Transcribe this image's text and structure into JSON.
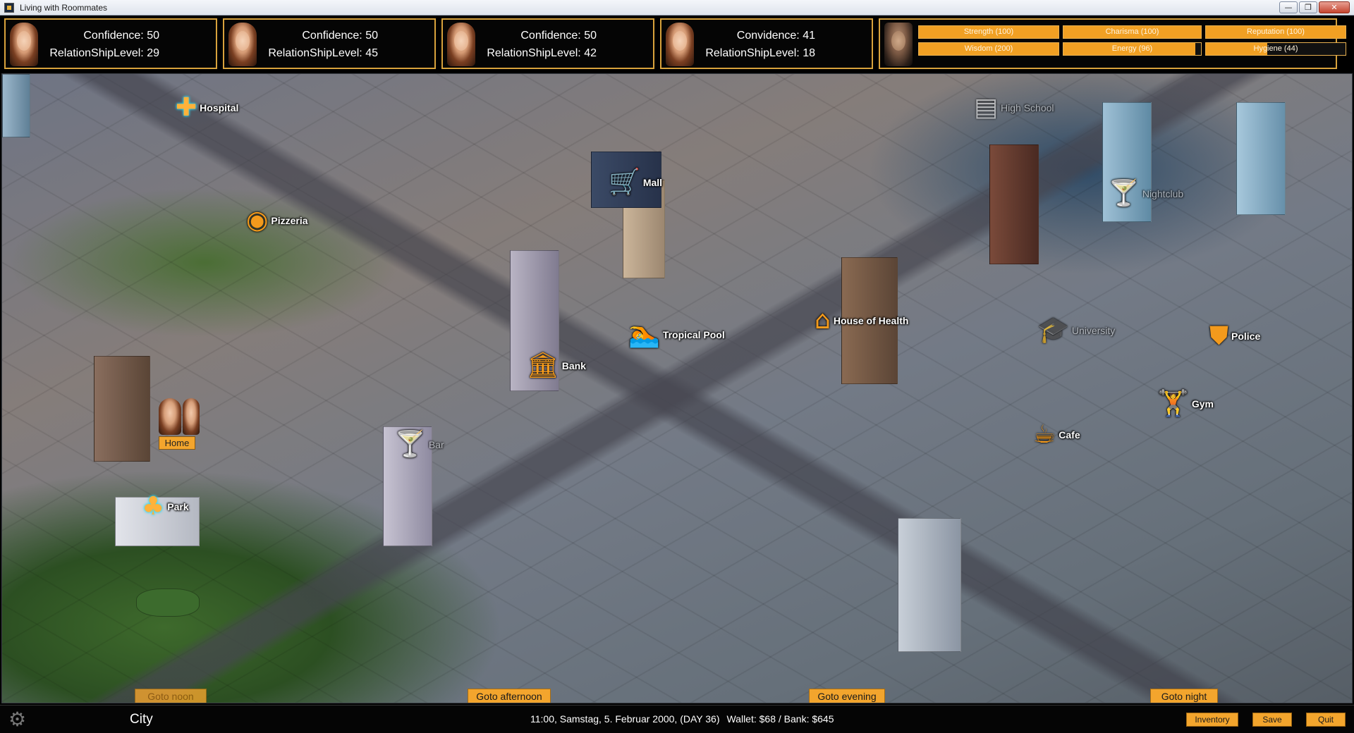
{
  "window": {
    "title": "Living with Roommates",
    "minimize": "—",
    "maximize": "❐",
    "close": "✕"
  },
  "roommates": [
    {
      "stat_label": "Confidence:",
      "stat_value": "50",
      "rel_label": "RelationShipLevel:",
      "rel_value": "29"
    },
    {
      "stat_label": "Confidence:",
      "stat_value": "50",
      "rel_label": "RelationShipLevel:",
      "rel_value": "45"
    },
    {
      "stat_label": "Confidence:",
      "stat_value": "50",
      "rel_label": "RelationShipLevel:",
      "rel_value": "42"
    },
    {
      "stat_label": "Convidence:",
      "stat_value": "41",
      "rel_label": "RelationShipLevel:",
      "rel_value": "18"
    }
  ],
  "player": {
    "stats": [
      {
        "label": "Strength (100)",
        "fill": 1.0
      },
      {
        "label": "Charisma (100)",
        "fill": 1.0
      },
      {
        "label": "Reputation (100)",
        "fill": 1.0
      },
      {
        "label": "Wisdom (200)",
        "fill": 1.0
      },
      {
        "label": "Energy (96)",
        "fill": 0.96
      },
      {
        "label": "Hygiene (44)",
        "fill": 0.44
      }
    ]
  },
  "map": {
    "locations": {
      "hospital": "Hospital",
      "mall": "Mall",
      "pizzeria": "Pizzeria",
      "high_school": "High School",
      "nightclub": "Nightclub",
      "house_of_health": "House of Health",
      "tropical_pool": "Tropical Pool",
      "bank": "Bank",
      "university": "University",
      "police": "Police",
      "gym": "Gym",
      "cafe": "Cafe",
      "bar": "Bar",
      "park": "Park",
      "home": "Home"
    },
    "icons": {
      "hospital": "hospital-cross-icon",
      "mall": "shopping-cart-icon",
      "pizzeria": "pizza-icon",
      "high_school": "book-stack-icon",
      "nightclub": "cocktail-glass-icon",
      "house_of_health": "house-icon",
      "tropical_pool": "swimmer-icon",
      "bank": "bank-building-icon",
      "university": "graduation-cap-icon",
      "police": "police-badge-icon",
      "gym": "bodybuilder-icon",
      "cafe": "coffee-cup-icon",
      "bar": "cocktail-glass-icon",
      "park": "park-icon"
    },
    "time_buttons": {
      "noon": "Goto noon",
      "afternoon": "Goto afternoon",
      "evening": "Goto evening",
      "night": "Goto night"
    }
  },
  "footer": {
    "location": "City",
    "datetime": "11:00, Samstag, 5. Februar 2000, (DAY 36)",
    "wallet": "Wallet: $68 / Bank: $645",
    "inventory": "Inventory",
    "save": "Save",
    "quit": "Quit"
  },
  "colors": {
    "accent": "#f3a52d",
    "border": "#d8a23c",
    "background": "#000000"
  }
}
